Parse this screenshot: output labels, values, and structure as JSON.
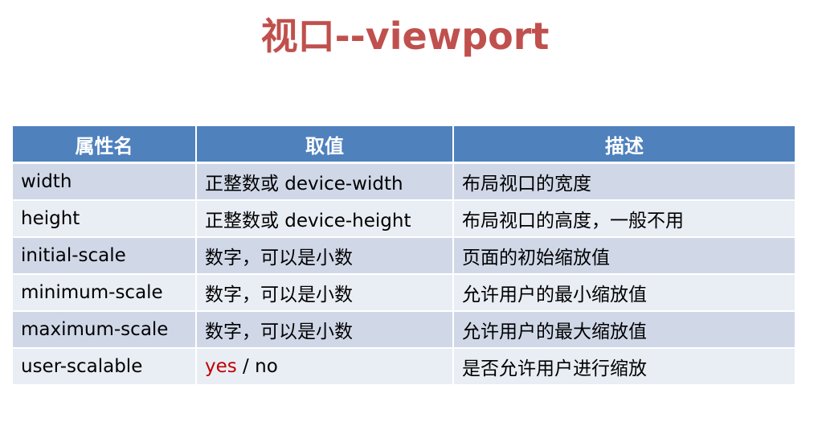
{
  "title": "视口--viewport",
  "table": {
    "headers": [
      "属性名",
      "取值",
      "描述"
    ],
    "rows": [
      {
        "name": "width",
        "value": "正整数或 device-width",
        "desc": "布局视口的宽度"
      },
      {
        "name": "height",
        "value": "正整数或 device-height",
        "desc": "布局视口的高度，一般不用"
      },
      {
        "name": "initial-scale",
        "value": "数字，可以是小数",
        "desc": "页面的初始缩放值"
      },
      {
        "name": "minimum-scale",
        "value": "数字，可以是小数",
        "desc": "允许用户的最小缩放值"
      },
      {
        "name": "maximum-scale",
        "value": "数字，可以是小数",
        "desc": "允许用户的最大缩放值"
      },
      {
        "name": "user-scalable",
        "value_highlight": "yes",
        "value_rest": " / no",
        "desc": "是否允许用户进行缩放"
      }
    ]
  },
  "colors": {
    "title": "#c0504d",
    "header_bg": "#4f81bd",
    "row_odd": "#d0d8e8",
    "row_even": "#e9edf4",
    "highlight": "#c00000"
  }
}
